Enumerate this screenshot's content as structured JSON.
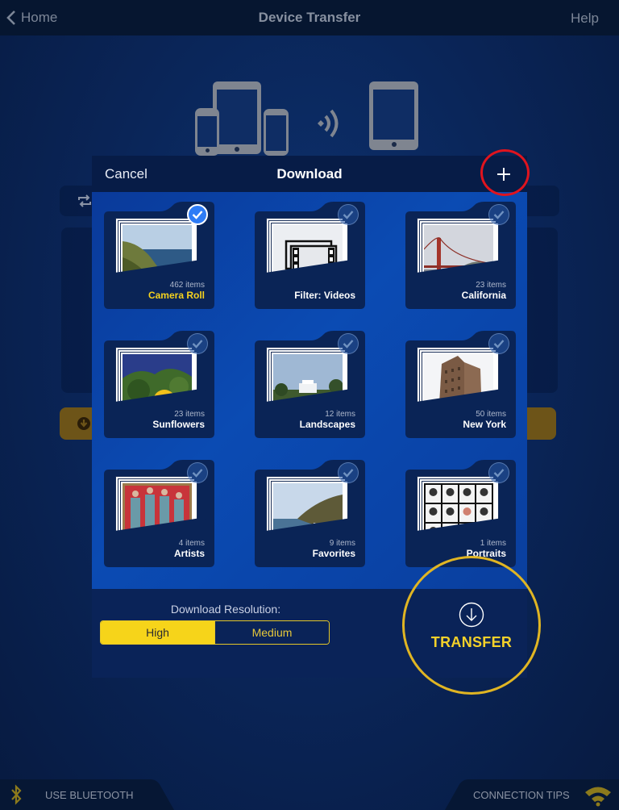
{
  "nav": {
    "back_label": "Home",
    "title": "Device Transfer",
    "help_label": "Help"
  },
  "modal": {
    "cancel_label": "Cancel",
    "title": "Download",
    "add_icon": "plus-icon"
  },
  "albums": [
    {
      "name": "Camera Roll",
      "count": "462 items",
      "selected": true,
      "thumb": "coast-cliff"
    },
    {
      "name": "Filter: Videos",
      "count": "",
      "selected": false,
      "thumb": "film-icon"
    },
    {
      "name": "California",
      "count": "23 items",
      "selected": false,
      "thumb": "golden-gate-bridge"
    },
    {
      "name": "Sunflowers",
      "count": "23 items",
      "selected": false,
      "thumb": "sunflower"
    },
    {
      "name": "Landscapes",
      "count": "12 items",
      "selected": false,
      "thumb": "white-villa"
    },
    {
      "name": "New York",
      "count": "50 items",
      "selected": false,
      "thumb": "skyscraper"
    },
    {
      "name": "Artists",
      "count": "4 items",
      "selected": false,
      "thumb": "four-figures-red"
    },
    {
      "name": "Favorites",
      "count": "9 items",
      "selected": false,
      "thumb": "sea-cliffs"
    },
    {
      "name": "Portraits",
      "count": "1 items",
      "selected": false,
      "thumb": "portrait-grid"
    }
  ],
  "resolution": {
    "label": "Download Resolution:",
    "options": [
      "High",
      "Medium"
    ],
    "selected": "High"
  },
  "transfer": {
    "label": "TRANSFER",
    "icon": "download-arrow-icon"
  },
  "bottom_bar": {
    "bluetooth_label": "USE BLUETOOTH",
    "tips_label": "CONNECTION TIPS"
  },
  "colors": {
    "accent_yellow": "#f6d41a",
    "selected_blue": "#2e7cf6",
    "annotation_red": "#e0141e",
    "annotation_gold": "#e0b523"
  }
}
